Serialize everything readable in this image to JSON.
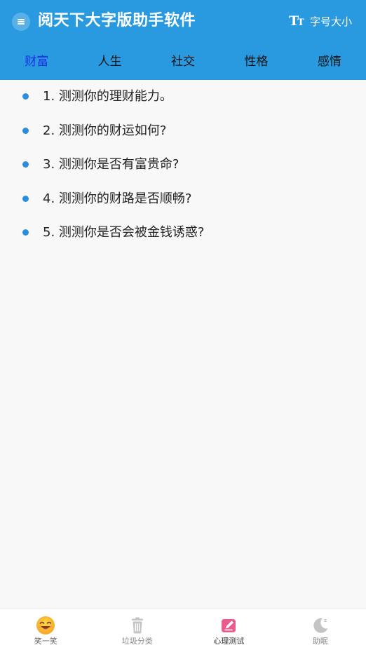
{
  "header": {
    "title": "阅天下大字版助手软件",
    "fontsize_label": "字号大小",
    "fontsize_icon_big": "T",
    "fontsize_icon_small": "T"
  },
  "tabs": [
    {
      "label": "财富",
      "active": true
    },
    {
      "label": "人生",
      "active": false
    },
    {
      "label": "社交",
      "active": false
    },
    {
      "label": "性格",
      "active": false
    },
    {
      "label": "感情",
      "active": false
    }
  ],
  "items": [
    {
      "text": "1. 测测你的理财能力。"
    },
    {
      "text": "2. 测测你的财运如何?"
    },
    {
      "text": "3. 测测你是否有富贵命?"
    },
    {
      "text": "4. 测测你的财路是否顺畅?"
    },
    {
      "text": "5. 测测你是否会被金钱诱惑?"
    }
  ],
  "bottom_nav": [
    {
      "label": "笑一笑",
      "icon": "smile-emoji-icon",
      "active": false
    },
    {
      "label": "垃圾分类",
      "icon": "trash-icon",
      "active": false
    },
    {
      "label": "心理测试",
      "icon": "edit-note-icon",
      "active": true
    },
    {
      "label": "助眠",
      "icon": "moon-sleep-icon",
      "active": false
    }
  ],
  "colors": {
    "header_bg": "#2a9ae0",
    "active_tab": "#1a2fe6",
    "bullet": "#2a8ee0",
    "active_nav_icon": "#ec5b8e"
  }
}
